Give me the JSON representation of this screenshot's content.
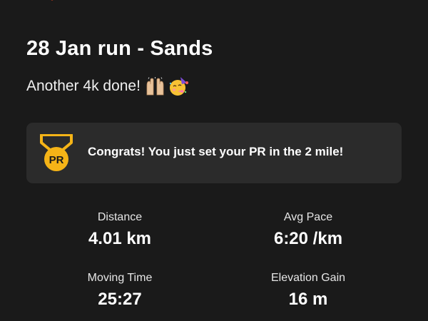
{
  "activity": {
    "title": "28 Jan run - Sands",
    "description": "Another 4k done!",
    "description_emojis": [
      "raising-hands-icon",
      "partying-face-icon"
    ]
  },
  "achievement": {
    "badge_text": "PR",
    "message": "Congrats! You just set your PR in the 2 mile!",
    "badge_color": "#f5b417"
  },
  "stats": {
    "distance": {
      "label": "Distance",
      "value": "4.01 km"
    },
    "avg_pace": {
      "label": "Avg Pace",
      "value": "6:20 /km"
    },
    "moving_time": {
      "label": "Moving Time",
      "value": "25:27"
    },
    "elevation_gain": {
      "label": "Elevation Gain",
      "value": "16 m"
    }
  },
  "colors": {
    "background": "#1a1a1a",
    "card": "#2b2b2b",
    "brand": "#fc4c02"
  }
}
